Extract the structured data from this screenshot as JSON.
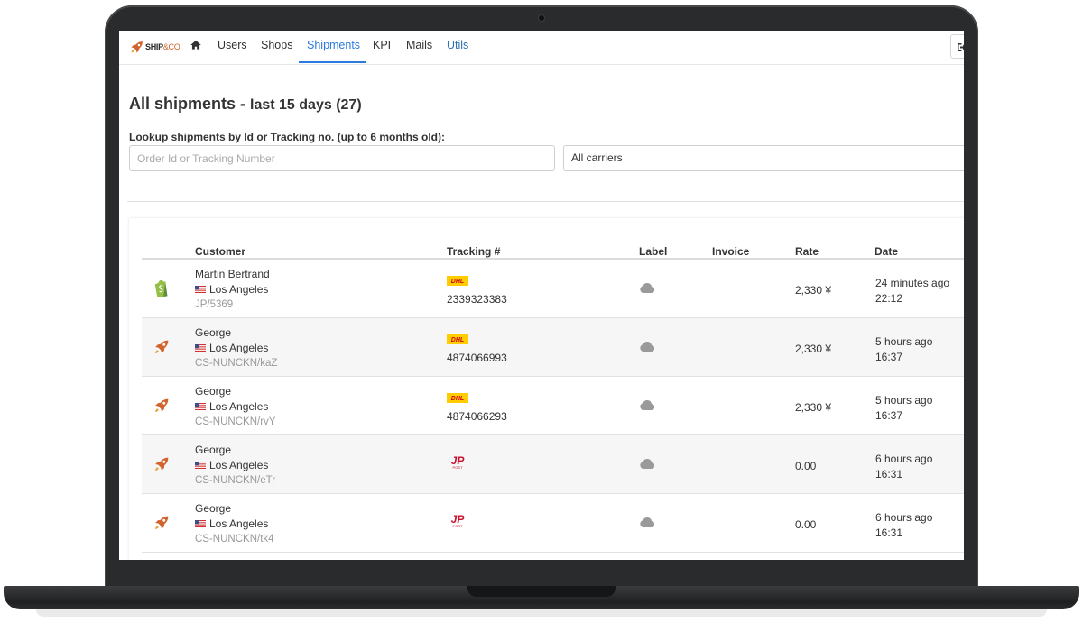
{
  "nav": {
    "logo": {
      "brand": "SHIP",
      "suffix": "&CO"
    },
    "items": [
      {
        "label": "Users"
      },
      {
        "label": "Shops"
      },
      {
        "label": "Shipments"
      },
      {
        "label": "KPI"
      },
      {
        "label": "Mails"
      },
      {
        "label": "Utils"
      }
    ],
    "active": "Shipments"
  },
  "page": {
    "title": "All shipments - ",
    "subtitle": "last 15 days (27)",
    "lookup_label": "Lookup shipments by Id or Tracking no. (up to 6 months old):",
    "lookup_placeholder": "Order Id or Tracking Number",
    "carrier_filter": "All carriers"
  },
  "table": {
    "headers": {
      "customer": "Customer",
      "tracking": "Tracking #",
      "label": "Label",
      "invoice": "Invoice",
      "rate": "Rate",
      "date": "Date"
    },
    "rows": [
      {
        "source": "shopify-icon",
        "name": "Martin Bertrand",
        "city": "Los Angeles",
        "ref": "JP/5369",
        "carrier": "dhl-logo",
        "tracking": "2339323383",
        "rate": "2,330 ¥",
        "date_relative": "24 minutes ago",
        "time": "22:12"
      },
      {
        "source": "rocket-icon",
        "name": "George",
        "city": "Los Angeles",
        "ref": "CS-NUNCKN/kaZ",
        "carrier": "dhl-logo",
        "tracking": "4874066993",
        "rate": "2,330 ¥",
        "date_relative": "5 hours ago",
        "time": "16:37"
      },
      {
        "source": "rocket-icon",
        "name": "George",
        "city": "Los Angeles",
        "ref": "CS-NUNCKN/rvY",
        "carrier": "dhl-logo",
        "tracking": "4874066293",
        "rate": "2,330 ¥",
        "date_relative": "5 hours ago",
        "time": "16:37"
      },
      {
        "source": "rocket-icon",
        "name": "George",
        "city": "Los Angeles",
        "ref": "CS-NUNCKN/eTr",
        "carrier": "jp-post-logo",
        "tracking": "",
        "rate": "0.00",
        "date_relative": "6 hours ago",
        "time": "16:31"
      },
      {
        "source": "rocket-icon",
        "name": "George",
        "city": "Los Angeles",
        "ref": "CS-NUNCKN/tk4",
        "carrier": "jp-post-logo",
        "tracking": "",
        "rate": "0.00",
        "date_relative": "6 hours ago",
        "time": "16:31"
      }
    ]
  },
  "colors": {
    "accent": "#2a7ae2",
    "brand_orange": "#d2632c",
    "dhl_yellow": "#ffcc00",
    "dhl_red": "#d40511",
    "jp_post_red": "#c8102e",
    "shopify_green": "#95bf47"
  }
}
